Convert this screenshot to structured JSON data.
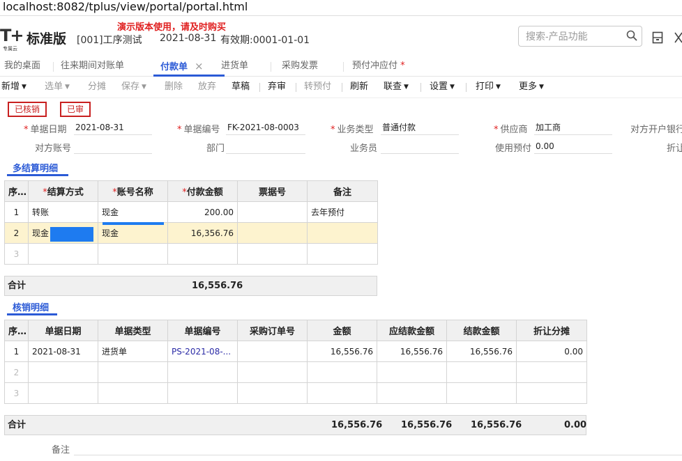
{
  "browser": {
    "url": "localhost:8082/tplus/view/portal/portal.html"
  },
  "header": {
    "logo_mark": "T+",
    "logo_sub": "专属云",
    "edition": "标准版",
    "company": "[001]工序测试",
    "date": "2021-08-31",
    "validity": "有效期:0001-01-01",
    "demo_notice": "演示版本使用，请及时购买",
    "search_placeholder": "搜索-产品功能"
  },
  "tabs": [
    {
      "label": "我的桌面"
    },
    {
      "label": "往来期间对账单"
    },
    {
      "label": "付款单",
      "active": true
    },
    {
      "label": "进货单"
    },
    {
      "label": "采购发票"
    },
    {
      "label": "预付冲应付",
      "star": "*"
    }
  ],
  "toolbar": [
    {
      "label": "新增",
      "dropdown": true
    },
    {
      "label": "选单",
      "dropdown": true,
      "disabled": true
    },
    {
      "label": "分摊",
      "disabled": true
    },
    {
      "label": "保存",
      "dropdown": true,
      "disabled": true
    },
    {
      "label": "删除",
      "disabled": true
    },
    {
      "label": "放弃",
      "disabled": true
    },
    {
      "label": "草稿"
    },
    {
      "label": "弃审"
    },
    {
      "label": "转预付",
      "disabled": true
    },
    {
      "label": "刷新"
    },
    {
      "label": "联查",
      "dropdown": true
    },
    {
      "label": "设置",
      "dropdown": true
    },
    {
      "label": "打印",
      "dropdown": true
    },
    {
      "label": "更多",
      "dropdown": true
    }
  ],
  "stamps": [
    "已核销",
    "已审"
  ],
  "form": {
    "doc_date_label": "单据日期",
    "doc_date": "2021-08-31",
    "doc_no_label": "单据编号",
    "doc_no": "FK-2021-08-0003",
    "biz_type_label": "业务类型",
    "biz_type": "普通付款",
    "supplier_label": "供应商",
    "supplier": "加工商",
    "bank_label": "对方开户银行",
    "account_label": "对方账号",
    "account": "",
    "dept_label": "部门",
    "dept": "",
    "clerk_label": "业务员",
    "clerk": "",
    "prepay_label": "使用预付",
    "prepay": "0.00",
    "discount_label": "折让"
  },
  "settlement": {
    "title": "多结算明细",
    "columns": [
      "序号",
      "结算方式",
      "账号名称",
      "付款金额",
      "票据号",
      "备注"
    ],
    "required": [
      false,
      true,
      true,
      true,
      false,
      false
    ],
    "rows": [
      [
        "1",
        "转账",
        "现金",
        "200.00",
        "",
        "去年预付"
      ],
      [
        "2",
        "现金",
        "现金",
        "16,356.76",
        "",
        ""
      ],
      [
        "3",
        "",
        "",
        "",
        "",
        ""
      ]
    ],
    "total_label": "合计",
    "total": "16,556.76"
  },
  "writeoff": {
    "title": "核销明细",
    "columns": [
      "序号",
      "单据日期",
      "单据类型",
      "单据编号",
      "采购订单号",
      "金额",
      "应结款金额",
      "结款金额",
      "折让分摊"
    ],
    "rows": [
      [
        "1",
        "2021-08-31",
        "进货单",
        "PS-2021-08-...",
        "",
        "16,556.76",
        "16,556.76",
        "16,556.76",
        "0.00"
      ],
      [
        "2",
        "",
        "",
        "",
        "",
        "",
        "",
        "",
        ""
      ],
      [
        "3",
        "",
        "",
        "",
        "",
        "",
        "",
        "",
        ""
      ]
    ],
    "total_label": "合计",
    "totals": {
      "amount": "16,556.76",
      "due": "16,556.76",
      "paid": "16,556.76",
      "discount": "0.00"
    }
  },
  "remark_label": "备注",
  "colors": {
    "accent": "#2b5ad6",
    "stamp": "#c82020",
    "required": "#e02020",
    "selected_row": "#fdf3cf"
  }
}
